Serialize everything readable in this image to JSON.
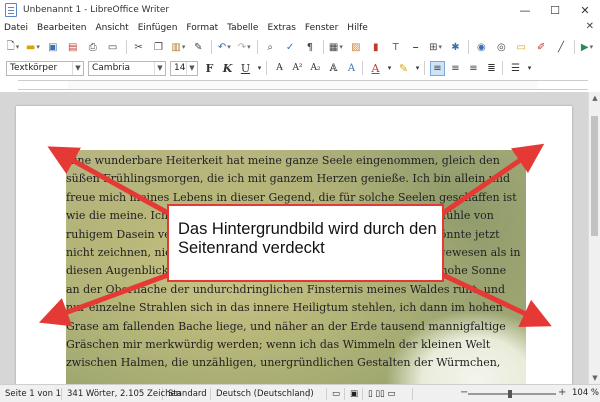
{
  "window": {
    "title": "Unbenannt 1 - LibreOffice Writer",
    "controls": {
      "minimize": "—",
      "maximize": "☐",
      "close": "✕"
    }
  },
  "menu": {
    "items": [
      "Datei",
      "Bearbeiten",
      "Ansicht",
      "Einfügen",
      "Format",
      "Tabelle",
      "Extras",
      "Fenster",
      "Hilfe"
    ],
    "close_doc": "✕"
  },
  "format_toolbar": {
    "paragraph_style": "Textkörper",
    "font_name": "Cambria",
    "font_size": "14",
    "bold": "F",
    "italic": "K",
    "underline": "U"
  },
  "document": {
    "lines": [
      "Eine wunderbare Heiterkeit hat meine ganze Seele eingenommen, gleich den",
      "süßen Frühlingsmorgen, die ich mit ganzem Herzen genieße. Ich bin allein und",
      "freue mich meines Lebens in dieser Gegend, die für solche Seelen geschaffen ist",
      "wie die meine. Ich bin so glücklich, mein Bester, so ganz in dem Gefühle von",
      "ruhigem Dasein versunken, daß meine Kunst darunter leidet. Ich könnte jetzt",
      "nicht zeichnen, nicht einen Strich, und bin nie ein größerer Maler gewesen als in",
      "diesen Augenblicken. Wenn das liebe Tal um mich dampft, und die hohe Sonne",
      "an der Oberfläche der undurchdringlichen Finsternis meines Waldes ruht, und",
      "nur einzelne Strahlen sich in das innere Heiligtum stehlen, ich dann im hohen",
      "Grase am fallenden Bache liege, und näher an der Erde tausend mannigfaltige",
      "Gräschen mir merkwürdig werden; wenn ich das Wimmeln der kleinen Welt",
      "zwischen Halmen, die unzähligen, unergründlichen Gestalten der Würmchen,"
    ]
  },
  "callout": {
    "text": "Das Hintergrundbild wird durch den Seitenrand verdeckt",
    "border_color": "#e53935"
  },
  "status": {
    "page": "Seite 1 von 1",
    "words": "341 Wörter, 2.105 Zeichen",
    "page_style": "Standard",
    "language": "Deutsch (Deutschland)",
    "zoom": "104 %"
  }
}
